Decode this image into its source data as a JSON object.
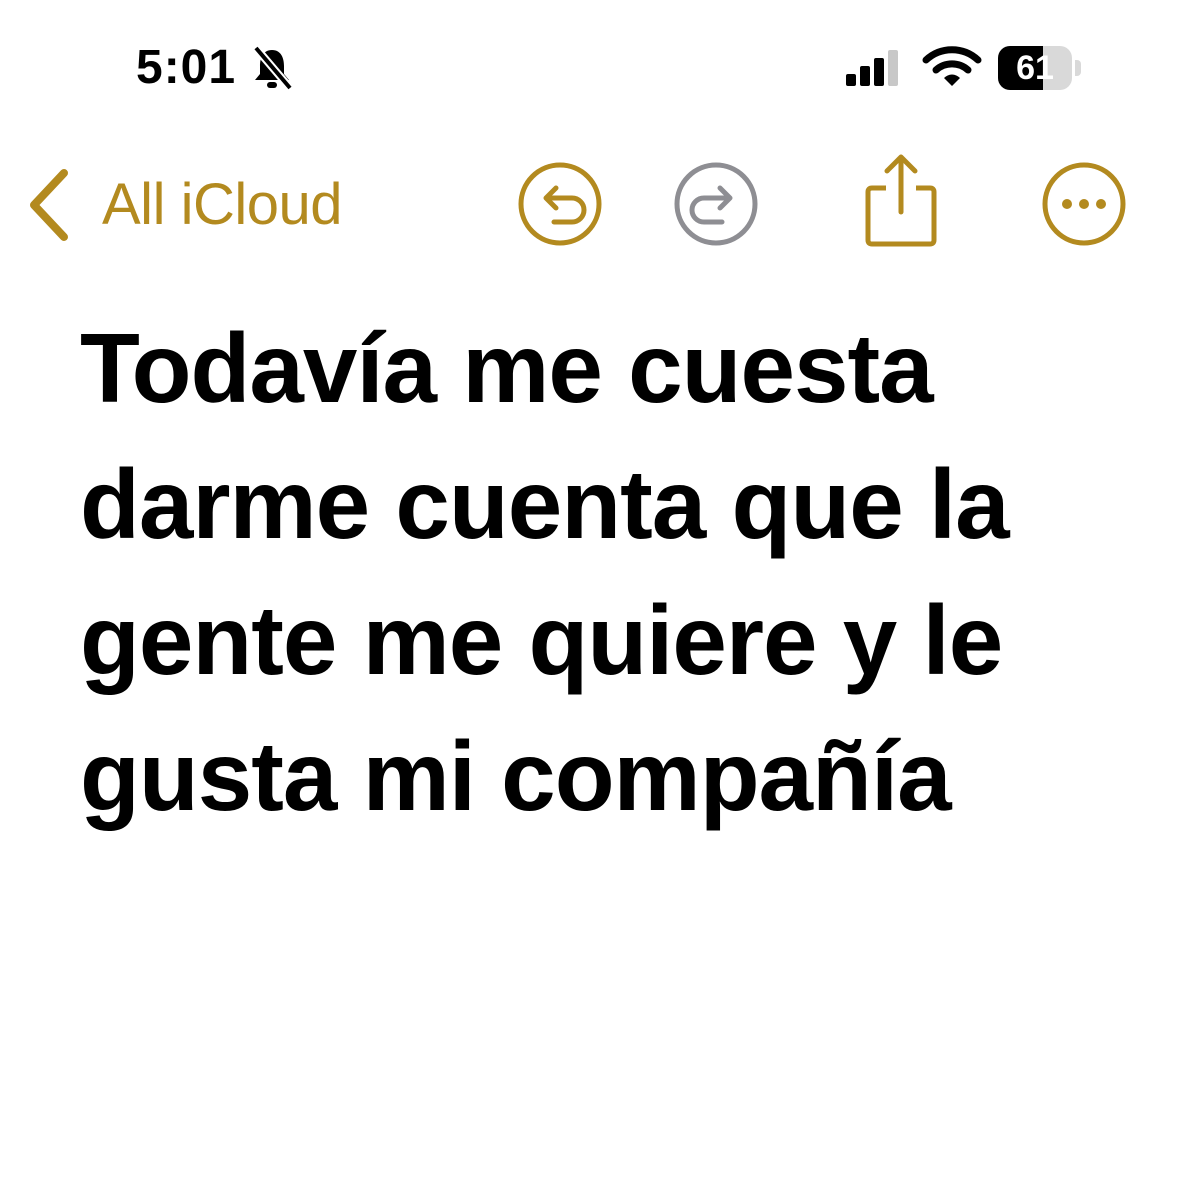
{
  "status_bar": {
    "time": "5:01",
    "battery_level": "61",
    "battery_fraction": 0.61,
    "icons": [
      "bell-slash-icon",
      "cellular-signal-icon",
      "wifi-icon",
      "battery-icon"
    ]
  },
  "nav": {
    "back_label": "All iCloud",
    "icons": [
      "chevron-left-icon",
      "undo-icon",
      "redo-icon",
      "share-icon",
      "more-icon"
    ]
  },
  "note": {
    "text": "Todavía me cuesta darme cuenta que la gente me quiere y le gusta mi compañía"
  },
  "colors": {
    "accent": "#b38a1f",
    "disabled": "#8e8e93",
    "text": "#000000",
    "background": "#ffffff"
  }
}
